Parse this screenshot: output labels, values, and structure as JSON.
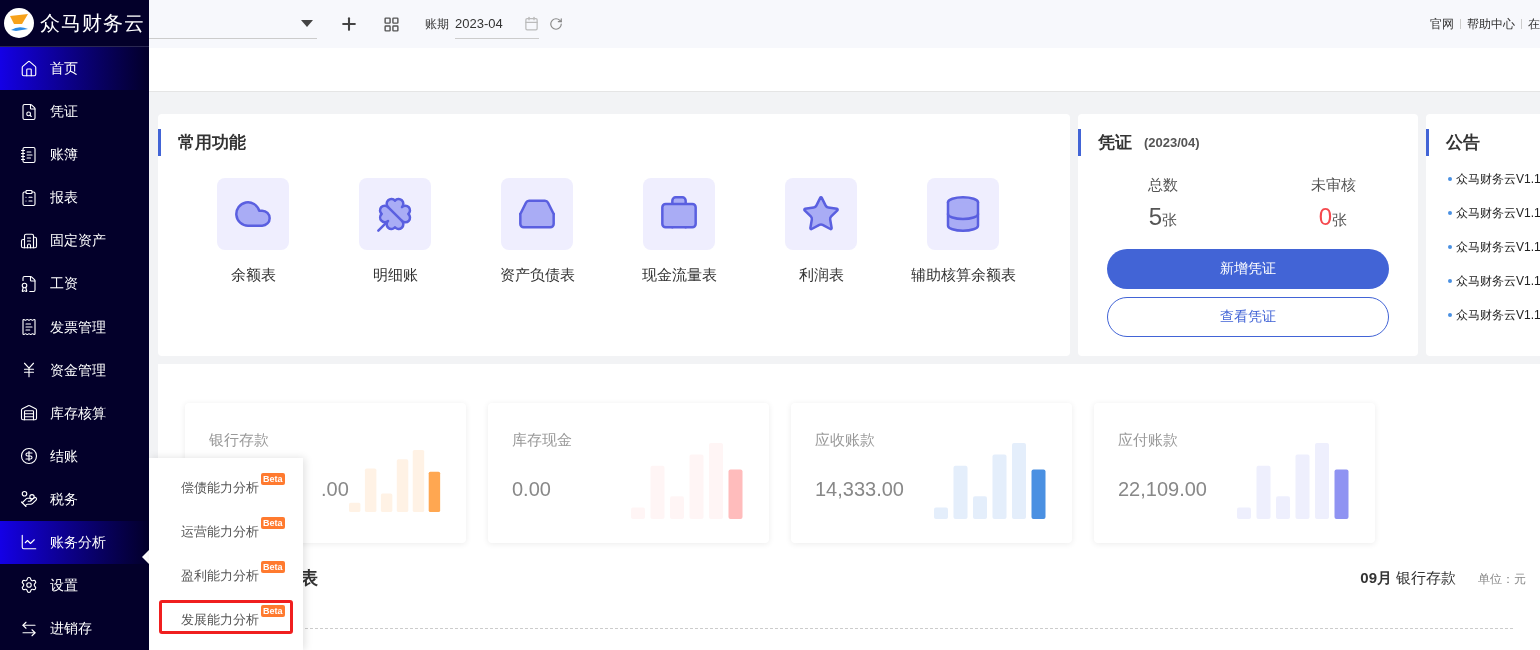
{
  "brand": {
    "name": "众马财务云"
  },
  "topbar": {
    "period_label": "账期",
    "period_value": "2023-04",
    "links": [
      "官网",
      "帮助中心",
      "在"
    ]
  },
  "sidebar": {
    "items": [
      {
        "label": "首页",
        "selected": true
      },
      {
        "label": "凭证",
        "selected": false
      },
      {
        "label": "账簿",
        "selected": false
      },
      {
        "label": "报表",
        "selected": false
      },
      {
        "label": "固定资产",
        "selected": false
      },
      {
        "label": "工资",
        "selected": false
      },
      {
        "label": "发票管理",
        "selected": false
      },
      {
        "label": "资金管理",
        "selected": false
      },
      {
        "label": "库存核算",
        "selected": false
      },
      {
        "label": "结账",
        "selected": false
      },
      {
        "label": "税务",
        "selected": false
      },
      {
        "label": "账务分析",
        "selected": true
      },
      {
        "label": "设置",
        "selected": false
      },
      {
        "label": "进销存",
        "selected": false
      }
    ]
  },
  "analysis_menu": {
    "items": [
      {
        "label": "偿债能力分析",
        "badge": "Beta",
        "highlighted": false
      },
      {
        "label": "运营能力分析",
        "badge": "Beta",
        "highlighted": false
      },
      {
        "label": "盈利能力分析",
        "badge": "Beta",
        "highlighted": false
      },
      {
        "label": "发展能力分析",
        "badge": "Beta",
        "highlighted": true
      }
    ]
  },
  "common_functions": {
    "title": "常用功能",
    "items": [
      {
        "label": "余额表"
      },
      {
        "label": "明细账"
      },
      {
        "label": "资产负债表"
      },
      {
        "label": "现金流量表"
      },
      {
        "label": "利润表"
      },
      {
        "label": "辅助核算余额表"
      }
    ]
  },
  "voucher": {
    "title": "凭证",
    "period": "(2023/04)",
    "stats": [
      {
        "label": "总数",
        "value": "5",
        "unit": "张",
        "color": "#555555"
      },
      {
        "label": "未审核",
        "value": "0",
        "unit": "张",
        "color": "#f5484d"
      }
    ],
    "primary_button": "新增凭证",
    "secondary_button": "查看凭证"
  },
  "notices": {
    "title": "公告",
    "items": [
      "众马财务云V1.1",
      "众马财务云V1.1",
      "众马财务云V1.1",
      "众马财务云V1.1",
      "众马财务云V1.1"
    ]
  },
  "stat_cards": [
    {
      "label": "银行存款",
      "value": ".00",
      "color": "#ffa751"
    },
    {
      "label": "库存现金",
      "value": "0.00",
      "color": "#ffbcbc"
    },
    {
      "label": "应收账款",
      "value": "14,333.00",
      "color": "#4a90e2"
    },
    {
      "label": "应付账款",
      "value": "22,109.00",
      "color": "#8f93f2"
    }
  ],
  "trend": {
    "title_visible": "表",
    "month": "09月",
    "account": "银行存款",
    "unit": "单位：元"
  }
}
